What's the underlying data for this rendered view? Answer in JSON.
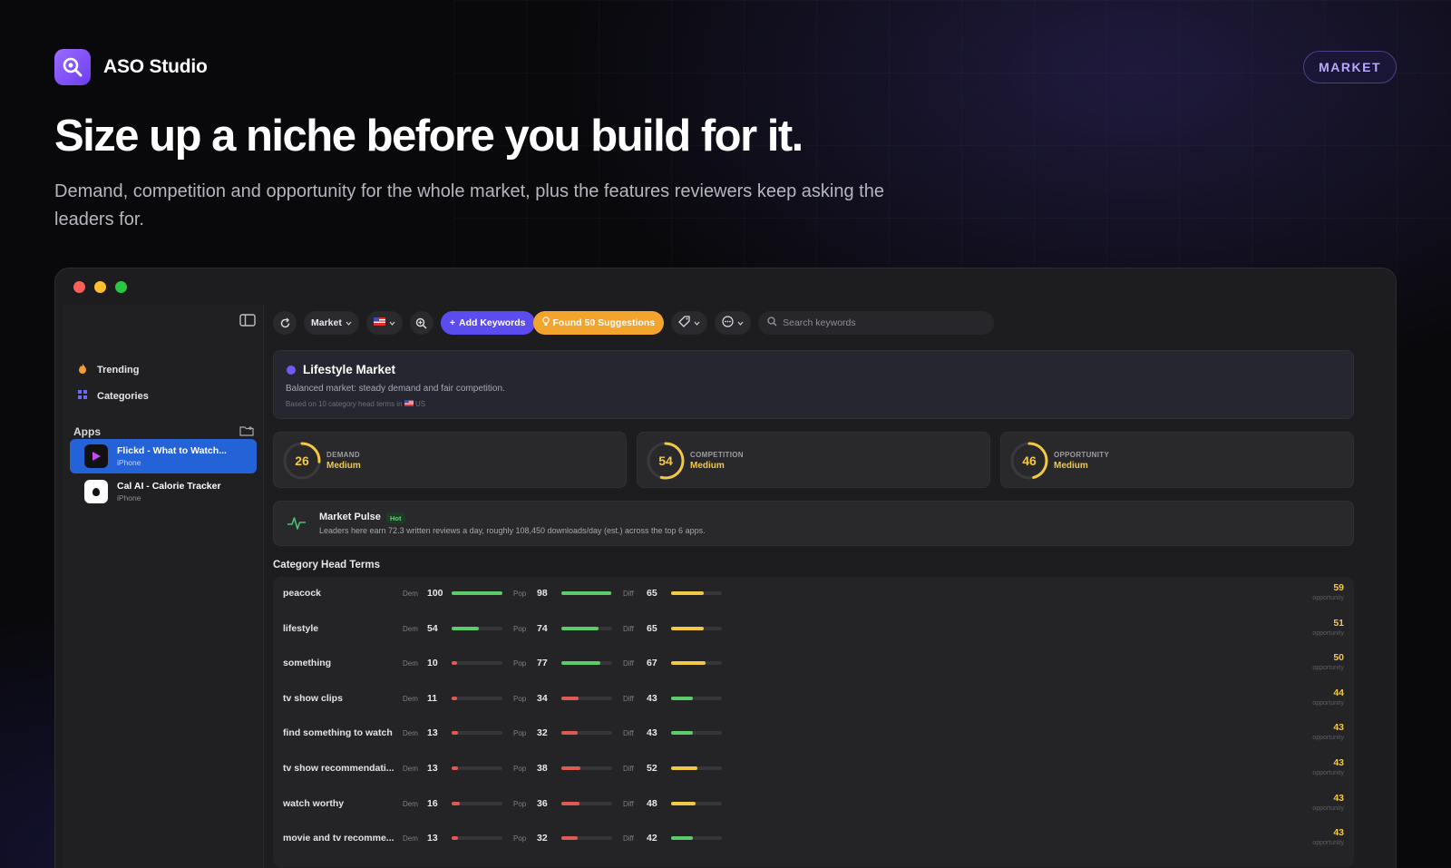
{
  "brand": {
    "name": "ASO Studio",
    "badge": "MARKET"
  },
  "hero": {
    "headline": "Size up a niche before you build for it.",
    "subhead": "Demand, competition and opportunity for the whole market, plus the features reviewers keep asking the leaders for."
  },
  "toolbar": {
    "market_label": "Market",
    "add_keywords_label": "Add Keywords",
    "found_label": "Found 50 Suggestions",
    "search_placeholder": "Search keywords"
  },
  "sidebar": {
    "nav": [
      {
        "label": "Trending"
      },
      {
        "label": "Categories"
      }
    ],
    "apps_heading": "Apps",
    "apps": [
      {
        "name": "Flickd - What to Watch...",
        "platform": "iPhone",
        "active": true
      },
      {
        "name": "Cal AI - Calorie Tracker",
        "platform": "iPhone",
        "active": false
      }
    ]
  },
  "market": {
    "title": "Lifestyle Market",
    "summary": "Balanced market: steady demand and fair competition.",
    "basis": "Based on 10 category head terms in",
    "basis_country": "US"
  },
  "metrics": [
    {
      "label": "DEMAND",
      "value": 26,
      "level": "Medium"
    },
    {
      "label": "COMPETITION",
      "value": 54,
      "level": "Medium"
    },
    {
      "label": "OPPORTUNITY",
      "value": 46,
      "level": "Medium"
    }
  ],
  "pulse": {
    "title": "Market Pulse",
    "tag": "Hot",
    "text": "Leaders here earn 72.3 written reviews a day, roughly 108,450 downloads/day (est.) across the top 6 apps."
  },
  "terms": {
    "title": "Category Head Terms",
    "labels": {
      "dem": "Dem",
      "pop": "Pop",
      "diff": "Diff",
      "opp": "opportunity"
    },
    "rows": [
      {
        "name": "peacock",
        "dem": 100,
        "pop": 98,
        "diff": 65,
        "opp": 59
      },
      {
        "name": "lifestyle",
        "dem": 54,
        "pop": 74,
        "diff": 65,
        "opp": 51
      },
      {
        "name": "something",
        "dem": 10,
        "pop": 77,
        "diff": 67,
        "opp": 50
      },
      {
        "name": "tv show clips",
        "dem": 11,
        "pop": 34,
        "diff": 43,
        "opp": 44
      },
      {
        "name": "find something to watch",
        "dem": 13,
        "pop": 32,
        "diff": 43,
        "opp": 43
      },
      {
        "name": "tv show recommendati...",
        "dem": 13,
        "pop": 38,
        "diff": 52,
        "opp": 43
      },
      {
        "name": "watch worthy",
        "dem": 16,
        "pop": 36,
        "diff": 48,
        "opp": 43
      },
      {
        "name": "movie and tv recomme...",
        "dem": 13,
        "pop": 32,
        "diff": 42,
        "opp": 43
      }
    ]
  },
  "colors": {
    "accent": "#6d3df0",
    "good": "#5ccb6a",
    "bad": "#e05a54",
    "warn": "#f3c845",
    "add_button": "#5b4cf0",
    "found_button": "#f2a42c",
    "active_app": "#2462d8"
  }
}
